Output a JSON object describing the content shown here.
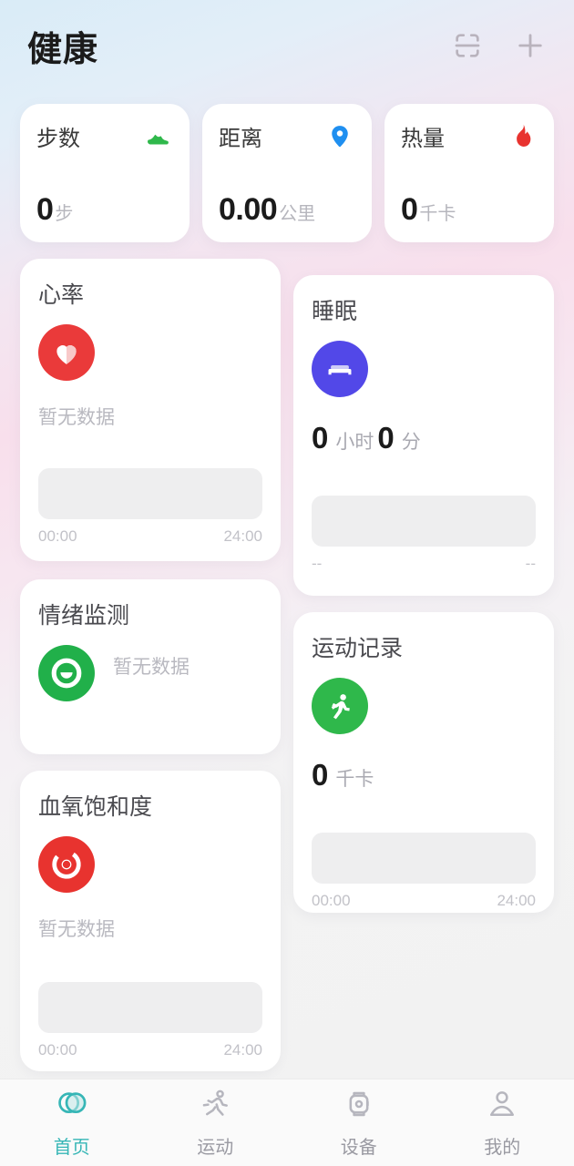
{
  "header": {
    "title": "健康",
    "actions": [
      {
        "name": "scan-card-icon",
        "label": "扫描"
      },
      {
        "name": "add-icon",
        "label": "添加"
      }
    ]
  },
  "colors": {
    "accent": "#36b6b6",
    "steps_icon": "#2fb84b",
    "distance_icon": "#1f8ff0",
    "calories_icon": "#e8332f",
    "heart_icon": "#ea3a3a",
    "sleep_icon": "#5248e8",
    "mood_icon": "#21b04a",
    "spo2_icon": "#e8332f",
    "sport_icon": "#2fb84b",
    "muted_text": "#b9b9c0"
  },
  "stats": [
    {
      "label": "步数",
      "value": "0",
      "unit": "步",
      "icon": "shoe-icon"
    },
    {
      "label": "距离",
      "value": "0.00",
      "unit": "公里",
      "icon": "location-pin-icon"
    },
    {
      "label": "热量",
      "value": "0",
      "unit": "千卡",
      "icon": "flame-icon"
    }
  ],
  "cards": {
    "heart_rate": {
      "title": "心率",
      "icon": "heart-icon",
      "status": "暂无数据",
      "axis_start": "00:00",
      "axis_end": "24:00"
    },
    "sleep": {
      "title": "睡眠",
      "icon": "bed-icon",
      "hours": "0",
      "hours_unit": "小时",
      "minutes": "0",
      "minutes_unit": "分",
      "axis_start": "--",
      "axis_end": "--"
    },
    "mood": {
      "title": "情绪监测",
      "icon": "smiley-icon",
      "status": "暂无数据"
    },
    "sport": {
      "title": "运动记录",
      "icon": "running-icon",
      "value": "0",
      "unit": "千卡",
      "axis_start": "00:00",
      "axis_end": "24:00"
    },
    "spo2": {
      "title": "血氧饱和度",
      "icon": "spo2-ring-icon",
      "status": "暂无数据",
      "axis_start": "00:00",
      "axis_end": "24:00"
    }
  },
  "bottom_nav": {
    "items": [
      {
        "label": "首页",
        "icon": "home-circles-icon",
        "active": true
      },
      {
        "label": "运动",
        "icon": "running-nav-icon",
        "active": false
      },
      {
        "label": "设备",
        "icon": "smartwatch-icon",
        "active": false
      },
      {
        "label": "我的",
        "icon": "person-icon",
        "active": false
      }
    ]
  }
}
